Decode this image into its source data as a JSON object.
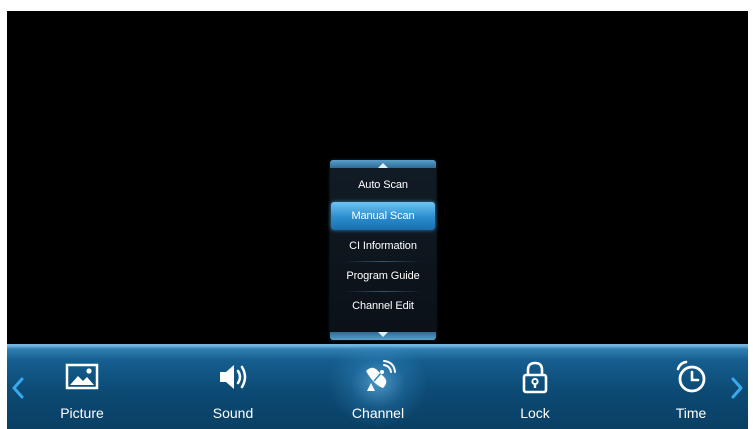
{
  "submenu": {
    "items": [
      {
        "label": "Auto Scan",
        "selected": false
      },
      {
        "label": "Manual Scan",
        "selected": true
      },
      {
        "label": "CI Information",
        "selected": false
      },
      {
        "label": "Program Guide",
        "selected": false
      },
      {
        "label": "Channel Edit",
        "selected": false
      }
    ]
  },
  "menubar": {
    "tabs": [
      {
        "label": "Picture",
        "icon": "picture-icon",
        "selected": false
      },
      {
        "label": "Sound",
        "icon": "speaker-icon",
        "selected": false
      },
      {
        "label": "Channel",
        "icon": "satellite-dish-icon",
        "selected": true
      },
      {
        "label": "Lock",
        "icon": "lock-icon",
        "selected": false
      },
      {
        "label": "Time",
        "icon": "clock-icon",
        "selected": false
      }
    ]
  },
  "colors": {
    "menubar": "#0c4a74",
    "highlight": "#2b8ccd",
    "screen_background": "#000000",
    "arrow": "#38a9ea"
  }
}
